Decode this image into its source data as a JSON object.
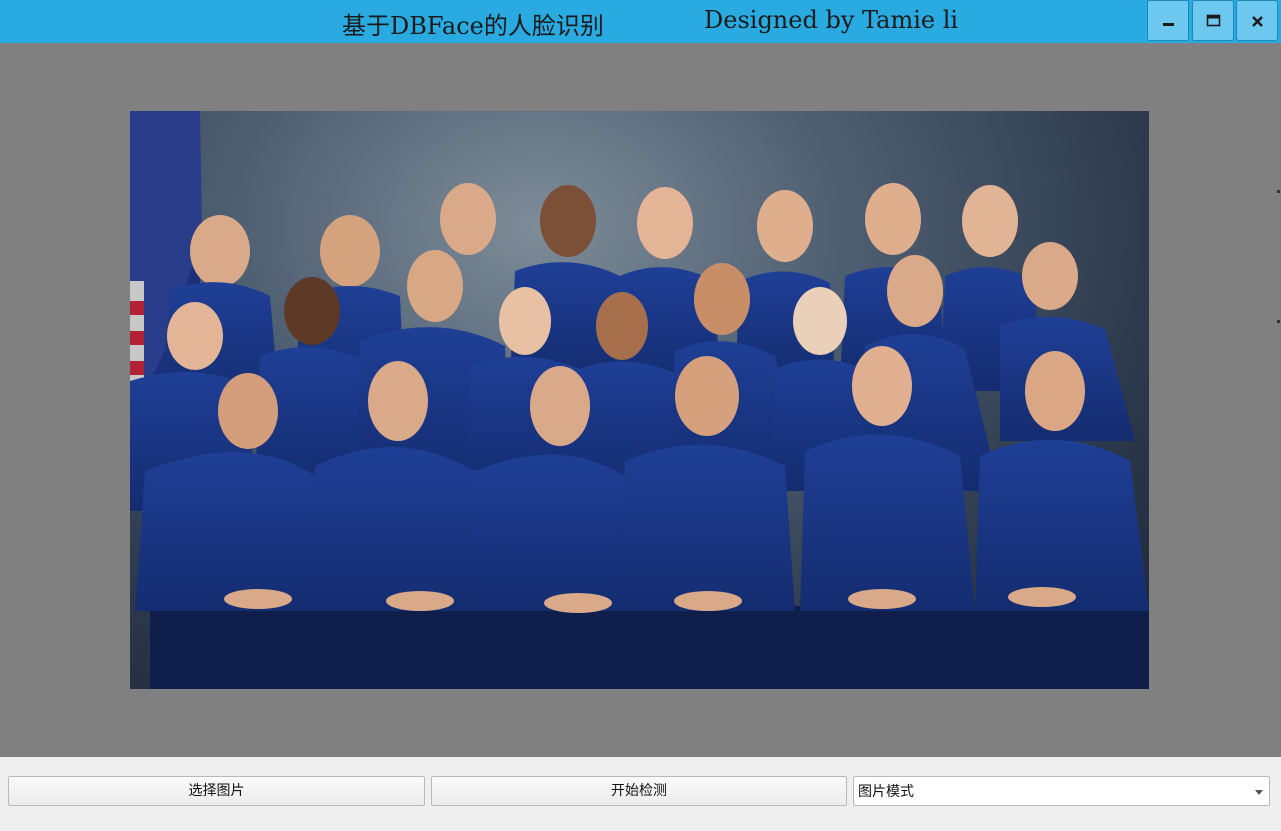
{
  "window": {
    "title_left": "基于DBFace的人脸识别",
    "title_right": "Designed by Tamie li",
    "minimize_icon": "minimize-icon",
    "maximize_icon": "maximize-icon",
    "close_icon": "close-icon"
  },
  "controls": {
    "select_image_label": "选择图片",
    "start_detect_label": "开始检测",
    "mode_select_value": "图片模式"
  },
  "colors": {
    "titlebar": "#29abe2",
    "canvas_bg": "#808080",
    "bottom_bar": "#efefef"
  }
}
